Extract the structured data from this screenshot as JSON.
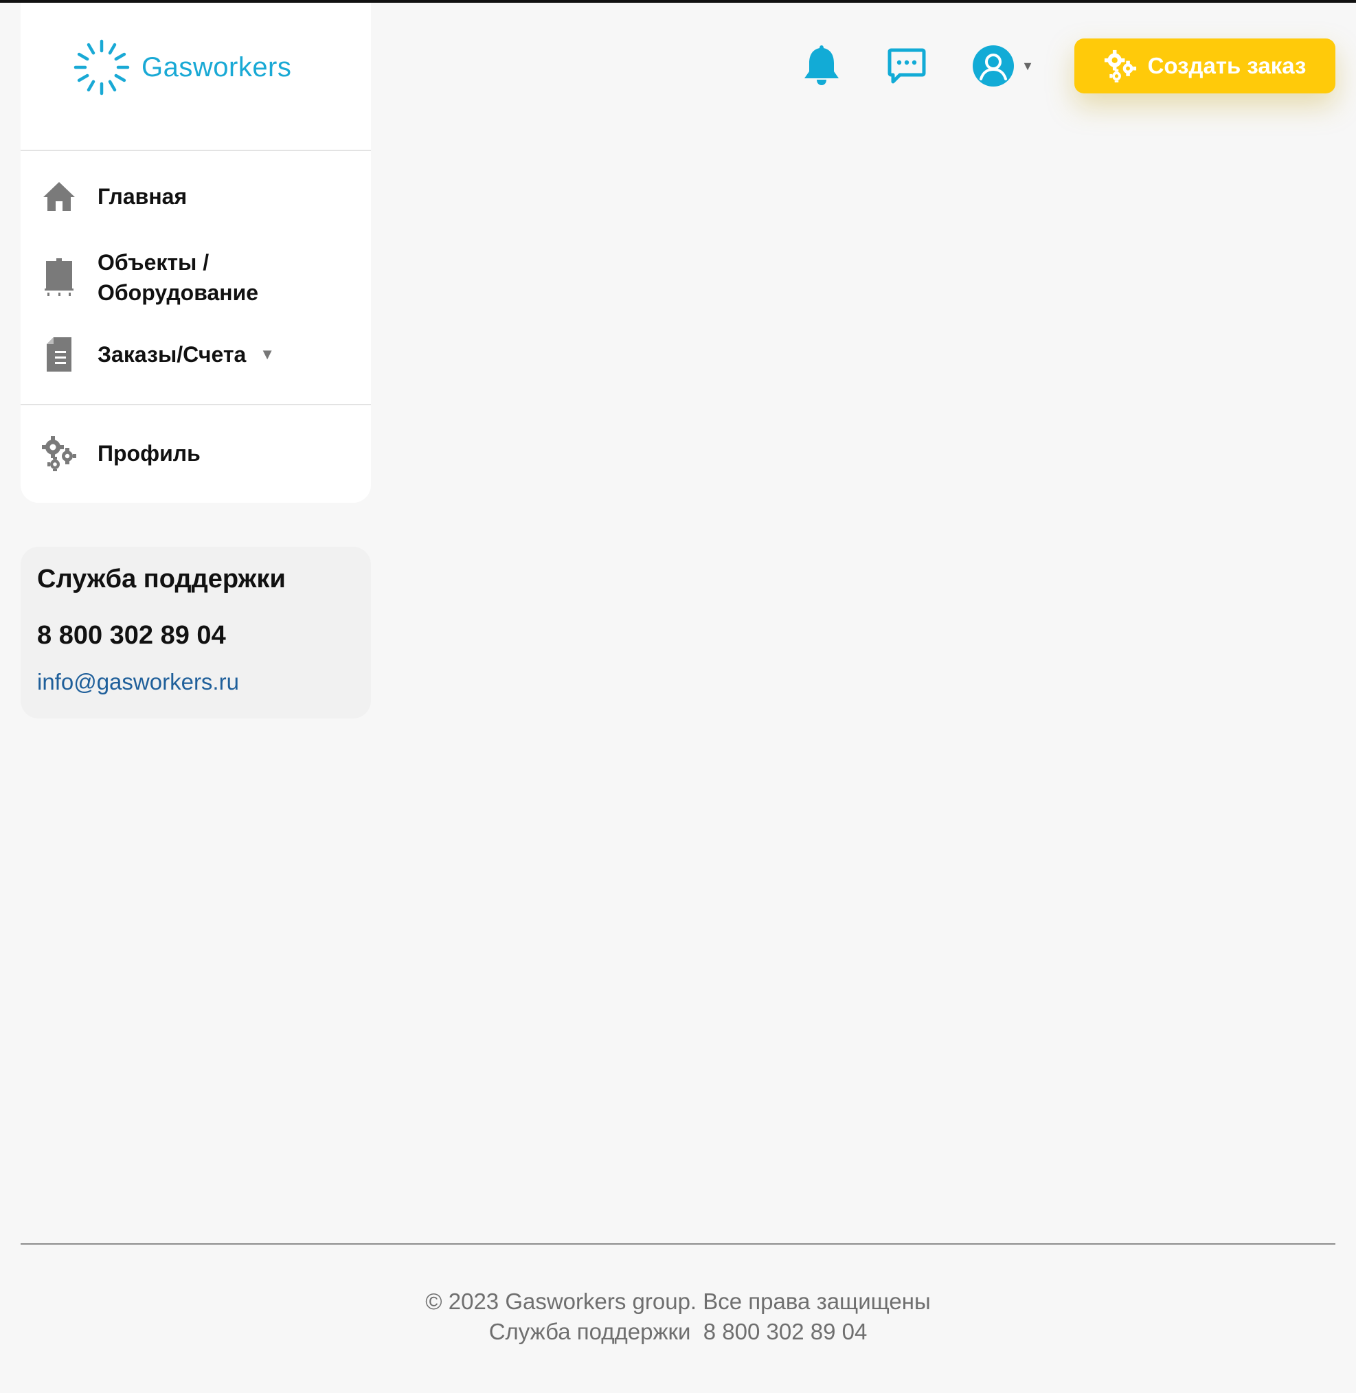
{
  "brand": {
    "name": "Gasworkers",
    "color": "#19a9d5"
  },
  "sidebar": {
    "items": [
      {
        "label": "Главная",
        "icon": "home-icon"
      },
      {
        "label": "Объекты / Оборудование",
        "icon": "equipment-icon"
      },
      {
        "label": "Заказы/Счета",
        "icon": "document-icon",
        "has_dropdown": true
      },
      {
        "label": "Профиль",
        "icon": "gears-icon"
      }
    ]
  },
  "support": {
    "title": "Служба поддержки",
    "phone": "8 800 302 89 04",
    "email": "info@gasworkers.ru"
  },
  "header": {
    "create_order_label": "Создать заказ",
    "accent_color": "#ffca0a",
    "icons": [
      "bell-icon",
      "chat-icon",
      "user-avatar-icon"
    ]
  },
  "footer": {
    "copyright": "© 2023 Gasworkers group. Все права защищены",
    "support_line": "Служба поддержки  8 800 302 89 04"
  }
}
